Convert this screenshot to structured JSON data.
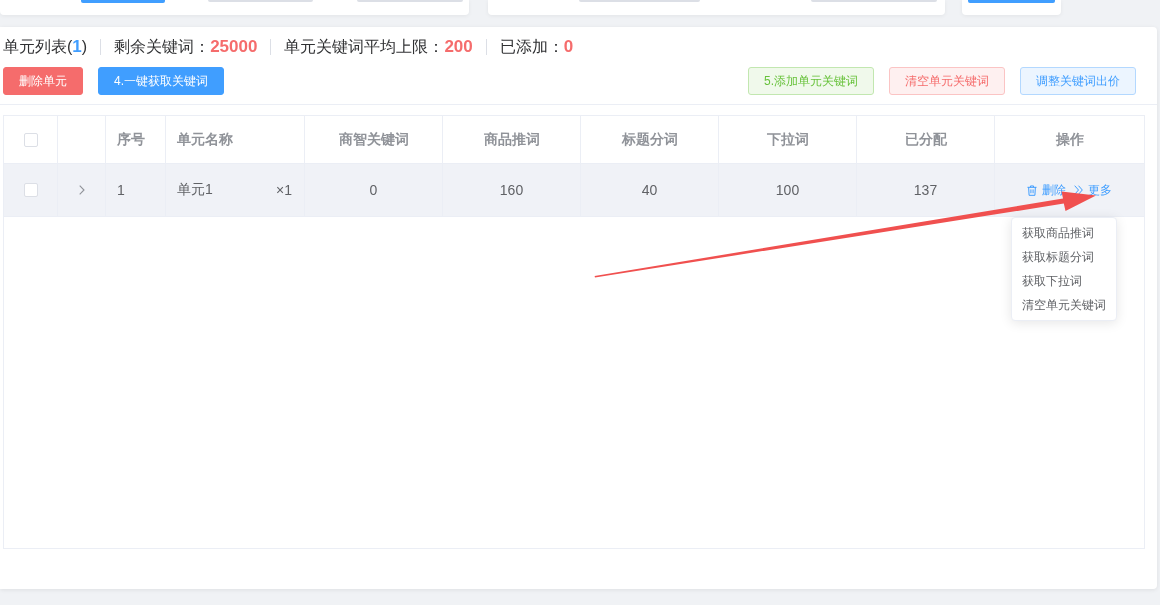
{
  "summary": [
    {
      "label": "单元列表(",
      "value": "1",
      "suffix": ")",
      "kind": "count"
    },
    {
      "label": "剩余关键词：",
      "value": "25000",
      "kind": "metric"
    },
    {
      "label": "单元关键词平均上限：",
      "value": "200",
      "kind": "metric"
    },
    {
      "label": "已添加：",
      "value": "0",
      "kind": "metric"
    }
  ],
  "toolbar": {
    "left_buttons": [
      {
        "label": "删除单元",
        "kind": "danger",
        "plain": false
      },
      {
        "label": "4.一键获取关键词",
        "kind": "primary",
        "plain": false
      }
    ],
    "right_buttons": [
      {
        "label": "5.添加单元关键词",
        "kind": "success",
        "plain": true
      },
      {
        "label": "清空单元关键词",
        "kind": "danger",
        "plain": true
      },
      {
        "label": "调整关键词出价",
        "kind": "primary",
        "plain": true
      }
    ]
  },
  "table": {
    "columns": [
      {
        "kind": "selection",
        "checked": false
      },
      {
        "kind": "expand"
      },
      {
        "kind": "index",
        "label": "序号"
      },
      {
        "kind": "name",
        "label": "单元名称"
      },
      {
        "kind": "number",
        "label": "商智关键词"
      },
      {
        "kind": "number",
        "label": "商品推词"
      },
      {
        "kind": "number",
        "label": "标题分词"
      },
      {
        "kind": "number",
        "label": "下拉词"
      },
      {
        "kind": "number",
        "label": "已分配"
      },
      {
        "kind": "actions",
        "label": "操作"
      }
    ],
    "rows": [
      {
        "checked": false,
        "expanded": false,
        "hovered": true,
        "index": "1",
        "name": "单元1",
        "multiplier": "×1",
        "values": [
          "0",
          "160",
          "40",
          "100",
          "137"
        ],
        "actions": [
          {
            "kind": "delete",
            "label": "删除"
          },
          {
            "kind": "more",
            "label": "更多"
          }
        ]
      }
    ]
  },
  "more_menu": {
    "open": true,
    "items": [
      "获取商品推词",
      "获取标题分词",
      "获取下拉词",
      "清空单元关键词"
    ]
  }
}
